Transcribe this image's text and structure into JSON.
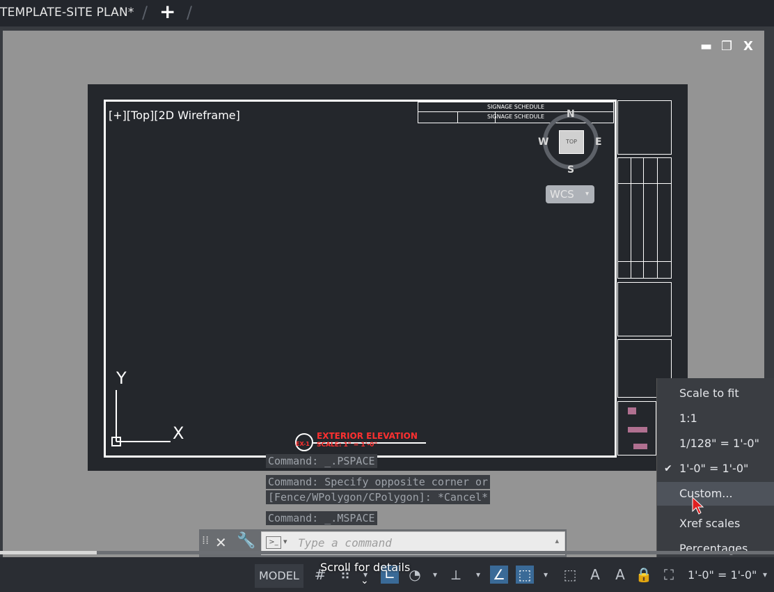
{
  "tabs": {
    "active_label": "TEMPLATE-SITE PLAN*",
    "new_tab_glyph": "+"
  },
  "window_controls": {
    "minimize": "▬",
    "restore": "❐",
    "close": "X"
  },
  "viewport": {
    "label": "[+][Top][2D Wireframe]"
  },
  "schedule": {
    "row1": "SIGNAGE SCHEDULE",
    "row2": "SIGNAGE SCHEDULE"
  },
  "viewcube": {
    "north": "N",
    "south": "S",
    "east": "E",
    "west": "W",
    "face": "TOP",
    "wcs": "WCS"
  },
  "ucs": {
    "y_label": "Y",
    "x_label": "X"
  },
  "elevation": {
    "title": "EXTERIOR ELEVATION",
    "scale": "SCALE: 1\" = 1'-0\"",
    "tag": "EX-1"
  },
  "command_history": [
    "Command: _.PSPACE",
    "Command: Specify opposite corner or",
    "[Fence/WPolygon/CPolygon]: *Cancel*",
    "Command: _.MSPACE"
  ],
  "command_input": {
    "placeholder": "Type a command"
  },
  "statusbar": {
    "model": "MODEL",
    "scale": "1'-0\" = 1'-0\""
  },
  "scale_menu": {
    "items": [
      "Scale to fit",
      "1:1",
      "1/128\" = 1'-0\"",
      "1'-0\" = 1'-0\"",
      "Custom...",
      "Xref scales",
      "Percentages"
    ],
    "checked_item": "1'-0\" = 1'-0\"",
    "hovered_item": "Custom..."
  },
  "overlay": {
    "scroll_hint": "Scroll for details",
    "progress": 0.125
  },
  "colors": {
    "accent": "#3a6a97",
    "annotation_red": "#ff3030"
  }
}
